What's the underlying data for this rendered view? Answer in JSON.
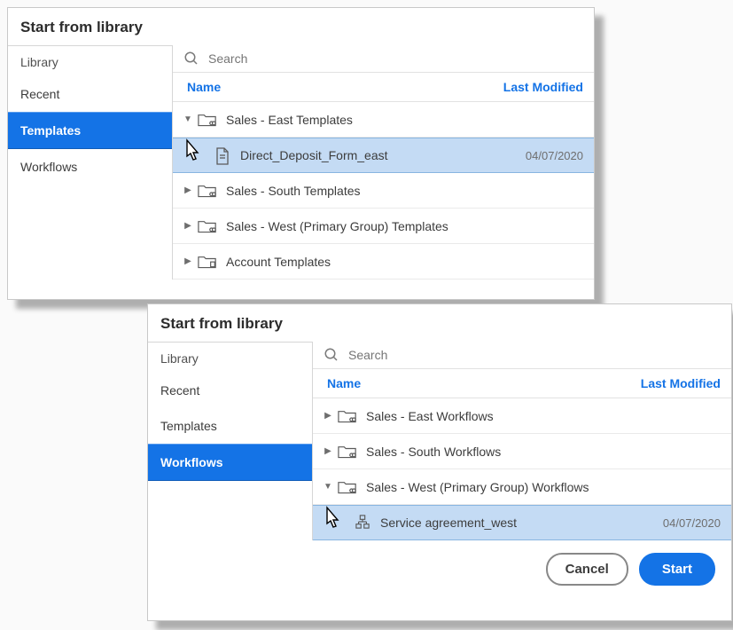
{
  "dialog1": {
    "title": "Start from library",
    "sidebar": {
      "heading": "Library",
      "items": [
        "Recent",
        "Templates",
        "Workflows"
      ],
      "activeIndex": 1
    },
    "search": {
      "placeholder": "Search"
    },
    "columns": {
      "name": "Name",
      "modified": "Last Modified"
    },
    "rows": [
      {
        "type": "folder",
        "expanded": true,
        "label": "Sales - East Templates",
        "icon": "folder-people"
      },
      {
        "type": "item",
        "selected": true,
        "label": "Direct_Deposit_Form_east",
        "date": "04/07/2020",
        "icon": "document"
      },
      {
        "type": "folder",
        "expanded": false,
        "label": "Sales - South Templates",
        "icon": "folder-people"
      },
      {
        "type": "folder",
        "expanded": false,
        "label": "Sales - West (Primary Group) Templates",
        "icon": "folder-people"
      },
      {
        "type": "folder",
        "expanded": false,
        "label": "Account Templates",
        "icon": "folder-org"
      }
    ]
  },
  "dialog2": {
    "title": "Start from library",
    "sidebar": {
      "heading": "Library",
      "items": [
        "Recent",
        "Templates",
        "Workflows"
      ],
      "activeIndex": 2
    },
    "search": {
      "placeholder": "Search"
    },
    "columns": {
      "name": "Name",
      "modified": "Last Modified"
    },
    "rows": [
      {
        "type": "folder",
        "expanded": false,
        "label": "Sales - East Workflows",
        "icon": "folder-people"
      },
      {
        "type": "folder",
        "expanded": false,
        "label": "Sales - South Workflows",
        "icon": "folder-people"
      },
      {
        "type": "folder",
        "expanded": true,
        "label": "Sales - West (Primary Group) Workflows",
        "icon": "folder-people"
      },
      {
        "type": "item",
        "selected": true,
        "label": "Service agreement_west",
        "date": "04/07/2020",
        "icon": "workflow"
      }
    ],
    "footer": {
      "cancel": "Cancel",
      "start": "Start"
    }
  }
}
